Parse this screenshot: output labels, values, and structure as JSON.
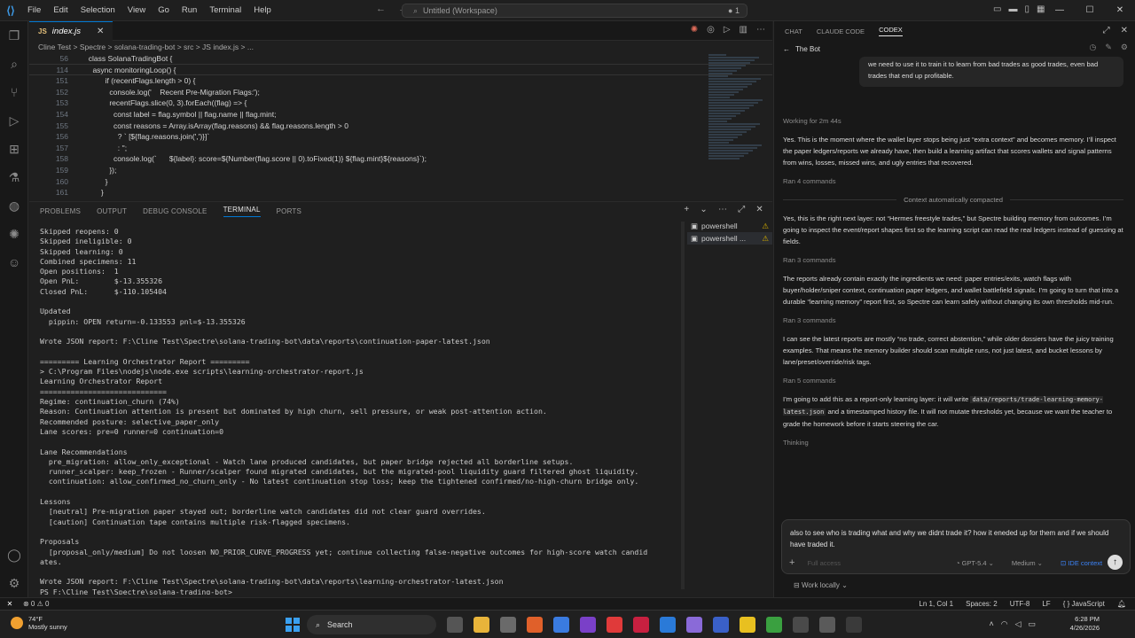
{
  "titlebar": {
    "menu": [
      "File",
      "Edit",
      "Selection",
      "View",
      "Go",
      "Run",
      "Terminal",
      "Help"
    ],
    "command_center": "Untitled (Workspace)",
    "indicator": "● 1"
  },
  "editor": {
    "tab": "index.js",
    "breadcrumb": "Cline Test  >  Spectre  >  solana-trading-bot  >  src  >  JS index.js  >  ...",
    "lines": [
      {
        "n": "56",
        "code": "  class SolanaTradingBot {"
      },
      {
        "n": "114",
        "code": "    async monitoringLoop() {"
      },
      {
        "n": "151",
        "code": "          if (recentFlags.length > 0) {"
      },
      {
        "n": "152",
        "code": "            console.log('    Recent Pre-Migration Flags:');"
      },
      {
        "n": "153",
        "code": "            recentFlags.slice(0, 3).forEach((flag) => {"
      },
      {
        "n": "154",
        "code": "              const label = flag.symbol || flag.name || flag.mint;"
      },
      {
        "n": "155",
        "code": "              const reasons = Array.isArray(flag.reasons) && flag.reasons.length > 0"
      },
      {
        "n": "156",
        "code": "                ? ` [${flag.reasons.join(',')}]`"
      },
      {
        "n": "157",
        "code": "                : '';"
      },
      {
        "n": "158",
        "code": "              console.log(`      ${label}: score=${Number(flag.score || 0).toFixed(1)} ${flag.mint}${reasons}`);"
      },
      {
        "n": "159",
        "code": "            });"
      },
      {
        "n": "160",
        "code": "          }"
      },
      {
        "n": "161",
        "code": "        }"
      }
    ]
  },
  "panel": {
    "tabs": [
      "PROBLEMS",
      "OUTPUT",
      "DEBUG CONSOLE",
      "TERMINAL",
      "PORTS"
    ],
    "active_tab": "TERMINAL",
    "terminals": [
      "powershell",
      "powershell ..."
    ],
    "terminal_lines": [
      "Skipped reopens: 0",
      "Skipped ineligible: 0",
      "Skipped learning: 0",
      "Combined specimens: 11",
      "Open positions:  1",
      "Open PnL:        $-13.355326",
      "Closed PnL:      $-110.105404",
      "",
      "Updated",
      "  pippin: OPEN return=-0.133553 pnl=$-13.355326",
      "",
      "Wrote JSON report: F:\\Cline Test\\Spectre\\solana-trading-bot\\data\\reports\\continuation-paper-latest.json",
      "",
      "========= Learning Orchestrator Report =========",
      "> C:\\Program Files\\nodejs\\node.exe scripts\\learning-orchestrator-report.js",
      "Learning Orchestrator Report",
      "=============================",
      "Regime: continuation_churn (74%)",
      "Reason: Continuation attention is present but dominated by high churn, sell pressure, or weak post-attention action.",
      "Recommended posture: selective_paper_only",
      "Lane scores: pre=0 runner=0 continuation=0",
      "",
      "Lane Recommendations",
      "  pre_migration: allow_only_exceptional - Watch lane produced candidates, but paper bridge rejected all borderline setups.",
      "  runner_scalper: keep_frozen - Runner/scalper found migrated candidates, but the migrated-pool liquidity guard filtered ghost liquidity.",
      "  continuation: allow_confirmed_no_churn_only - No latest continuation stop loss; keep the tightened confirmed/no-high-churn bridge only.",
      "",
      "Lessons",
      "  [neutral] Pre-migration paper stayed out; borderline watch candidates did not clear guard overrides.",
      "  [caution] Continuation tape contains multiple risk-flagged specimens.",
      "",
      "Proposals",
      "  [proposal_only/medium] Do not loosen NO_PRIOR_CURVE_PROGRESS yet; continue collecting false-negative outcomes for high-score watch candid",
      "ates.",
      "",
      "Wrote JSON report: F:\\Cline Test\\Spectre\\solana-trading-bot\\data\\reports\\learning-orchestrator-latest.json",
      "PS F:\\Cline Test\\Spectre\\solana-trading-bot> "
    ]
  },
  "chat": {
    "tabs": [
      "CHAT",
      "CLAUDE CODE",
      "CODEX"
    ],
    "active_tab": "CODEX",
    "thread_title": "The Bot",
    "user_message": "we need to use it to train it to learn from bad trades as good trades, even bad trades that end up profitable.",
    "working": "Working for 2m 44s",
    "messages": [
      {
        "kind": "text",
        "text": "Yes. This is the moment where the wallet layer stops being just “extra context” and becomes memory. I’ll inspect the paper ledgers/reports we already have, then build a learning artifact that scores wallets and signal patterns from wins, losses, missed wins, and ugly entries that recovered."
      },
      {
        "kind": "meta",
        "text": "Ran 4 commands"
      },
      {
        "kind": "sep",
        "text": "Context automatically compacted"
      },
      {
        "kind": "text",
        "text": "Yes, this is the right next layer: not “Hermes freestyle trades,” but Spectre building memory from outcomes. I’m going to inspect the event/report shapes first so the learning script can read the real ledgers instead of guessing at fields."
      },
      {
        "kind": "meta",
        "text": "Ran 3 commands"
      },
      {
        "kind": "text",
        "text": "The reports already contain exactly the ingredients we need: paper entries/exits, watch flags with buyer/holder/sniper context, continuation paper ledgers, and wallet battlefield signals. I’m going to turn that into a durable “learning memory” report first, so Spectre can learn safely without changing its own thresholds mid-run."
      },
      {
        "kind": "meta",
        "text": "Ran 3 commands"
      },
      {
        "kind": "text",
        "text": "I can see the latest reports are mostly “no trade, correct abstention,” while older dossiers have the juicy training examples. That means the memory builder should scan multiple runs, not just latest, and bucket lessons by lane/preset/override/risk tags."
      },
      {
        "kind": "meta",
        "text": "Ran 5 commands"
      }
    ],
    "final_pre": "I’m going to add this as a report-only learning layer: it will write ",
    "final_code": "data/reports/trade-learning-memory-latest.json",
    "final_post": " and a timestamped history file. It will not mutate thresholds yet, because we want the teacher to grade the homework before it starts steering the car.",
    "thinking": "Thinking",
    "composer_text": "also to see who is trading what and why we didnt trade it? how it eneded up for them and if we should have traded it.",
    "access": "Full access",
    "model": "GPT-5.4",
    "effort": "Medium",
    "ide_context": "IDE context",
    "work_locally": "Work locally"
  },
  "statusbar": {
    "left": "⊗ 0  ⚠ 0",
    "cursor": "Ln 1, Col 1",
    "spaces": "Spaces: 2",
    "encoding": "UTF-8",
    "eol": "LF",
    "language": "{ } JavaScript"
  },
  "taskbar": {
    "temp": "74°F",
    "weather": "Mostly sunny",
    "search": "Search",
    "time": "6:28 PM",
    "date": "4/26/2026"
  }
}
